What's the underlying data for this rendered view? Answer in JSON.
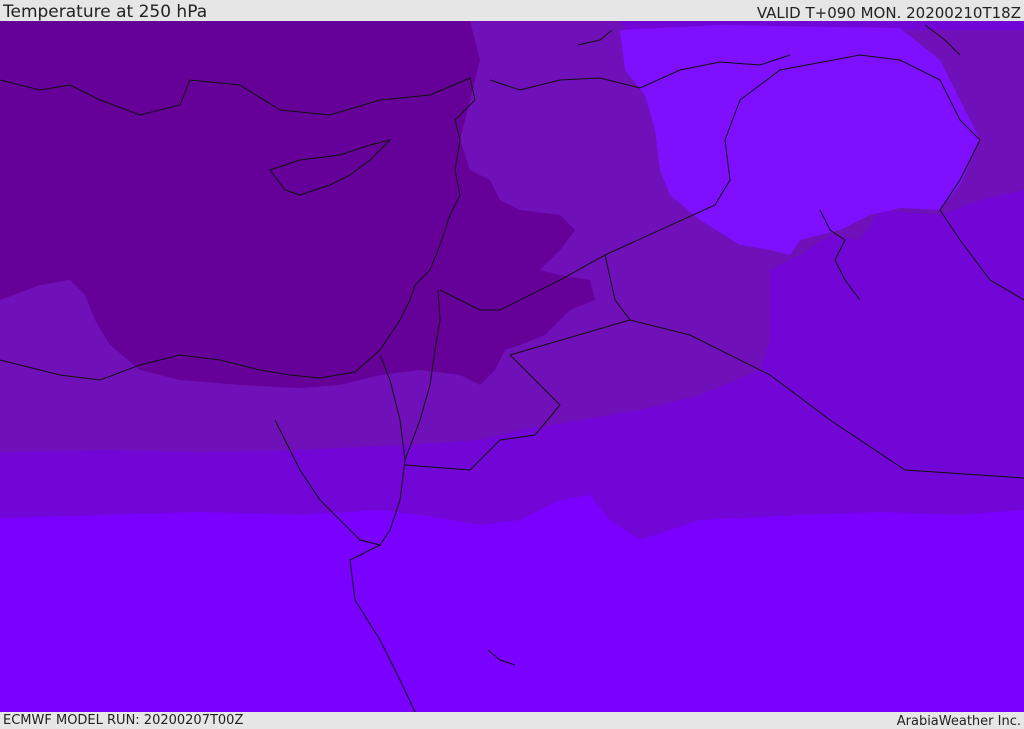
{
  "header": {
    "title": "Temperature at 250 hPa",
    "valid": "VALID T+090 MON. 20200210T18Z"
  },
  "footer": {
    "model_run": "ECMWF MODEL RUN: 20200207T00Z",
    "credit": "ArabiaWeather Inc."
  },
  "map": {
    "colors": {
      "coldest": "#650099",
      "cold": "#7010b8",
      "mid": "#7206d6",
      "base": "#7a00ff",
      "warm_patch": "#7f0fff",
      "coastline": "#111111"
    }
  }
}
